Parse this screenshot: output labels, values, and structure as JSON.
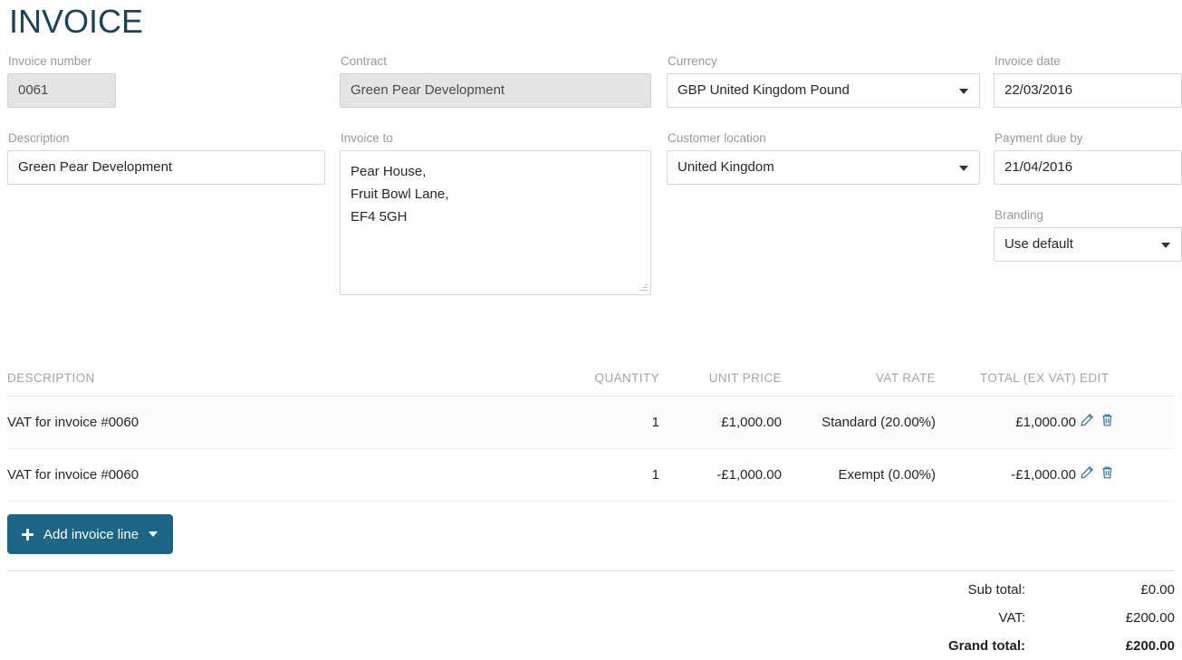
{
  "page_title": "INVOICE",
  "form": {
    "invoice_number": {
      "label": "Invoice number",
      "value": "0061",
      "disabled": true
    },
    "contract": {
      "label": "Contract",
      "value": "Green Pear Development",
      "disabled": true
    },
    "currency": {
      "label": "Currency",
      "value": "GBP United Kingdom Pound"
    },
    "invoice_date": {
      "label": "Invoice date",
      "value": "22/03/2016"
    },
    "description": {
      "label": "Description",
      "value": "Green Pear Development"
    },
    "invoice_to": {
      "label": "Invoice to",
      "value": "Pear House,\nFruit Bowl Lane,\nEF4 5GH"
    },
    "customer_location": {
      "label": "Customer location",
      "value": "United Kingdom"
    },
    "payment_due_by": {
      "label": "Payment due by",
      "value": "21/04/2016"
    },
    "branding": {
      "label": "Branding",
      "value": "Use default"
    }
  },
  "lines_table": {
    "headers": {
      "description": "DESCRIPTION",
      "quantity": "QUANTITY",
      "unit_price": "UNIT PRICE",
      "vat_rate": "VAT RATE",
      "total_ex_vat": "TOTAL (EX VAT)",
      "edit": "EDIT"
    },
    "rows": [
      {
        "description": "VAT for invoice #0060",
        "quantity": "1",
        "unit_price": "£1,000.00",
        "vat_rate": "Standard (20.00%)",
        "total_ex_vat": "£1,000.00"
      },
      {
        "description": "VAT for invoice #0060",
        "quantity": "1",
        "unit_price": "-£1,000.00",
        "vat_rate": "Exempt (0.00%)",
        "total_ex_vat": "-£1,000.00"
      }
    ]
  },
  "add_button": {
    "label": "Add invoice line"
  },
  "totals": {
    "sub_total": {
      "label": "Sub total:",
      "value": "£0.00"
    },
    "vat": {
      "label": "VAT:",
      "value": "£200.00"
    },
    "grand_total": {
      "label": "Grand total:",
      "value": "£200.00"
    }
  },
  "colors": {
    "title": "#1d4456",
    "button": "#1c6685",
    "icon": "#2f7496"
  }
}
